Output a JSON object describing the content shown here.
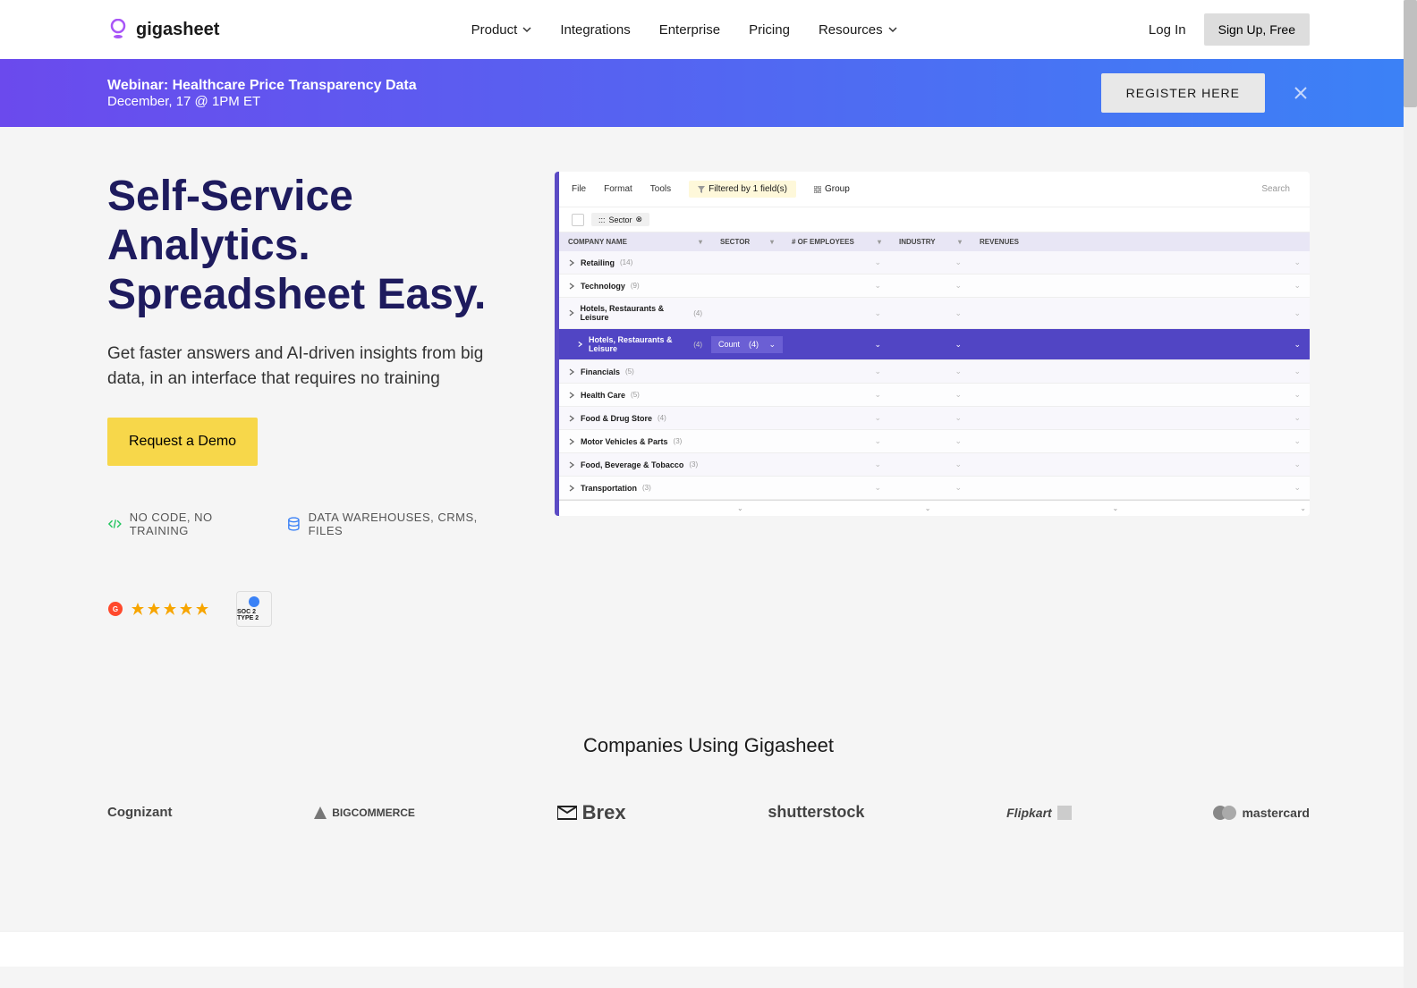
{
  "header": {
    "brand": "gigasheet",
    "nav": {
      "product": "Product",
      "integrations": "Integrations",
      "enterprise": "Enterprise",
      "pricing": "Pricing",
      "resources": "Resources"
    },
    "login": "Log In",
    "signup": "Sign Up, Free"
  },
  "banner": {
    "title": "Webinar: Healthcare Price Transparency Data",
    "subtitle": "December, 17 @ 1PM ET",
    "register": "REGISTER HERE"
  },
  "hero": {
    "title_line1": "Self-Service Analytics.",
    "title_line2": "Spreadsheet Easy.",
    "subtitle": "Get faster answers and AI-driven insights from big data, in an interface that requires no training",
    "cta": "Request a Demo",
    "tag1": "NO CODE, NO TRAINING",
    "tag2": "DATA WAREHOUSES, CRMS, FILES",
    "soc_label": "SOC 2 TYPE 2"
  },
  "screenshot": {
    "menu": {
      "file": "File",
      "format": "Format",
      "tools": "Tools"
    },
    "filter_label": "Filtered by 1 field(s)",
    "group_label": "Group",
    "search_placeholder": "Search",
    "chip": "Sector",
    "headers": {
      "c0": "COMPANY NAME",
      "c1": "SECTOR",
      "c2": "# OF EMPLOYEES",
      "c3": "INDUSTRY",
      "c4": "REVENUES"
    },
    "rows": [
      {
        "label": "Retailing",
        "count": "(14)"
      },
      {
        "label": "Technology",
        "count": "(9)"
      },
      {
        "label": "Hotels, Restaurants & Leisure",
        "count": "(4)"
      },
      {
        "label": "Hotels, Restaurants & Leisure",
        "count": "(4)",
        "highlight": true,
        "agg": "Count",
        "agg_count": "(4)"
      },
      {
        "label": "Financials",
        "count": "(5)"
      },
      {
        "label": "Health Care",
        "count": "(5)"
      },
      {
        "label": "Food & Drug Store",
        "count": "(4)"
      },
      {
        "label": "Motor Vehicles & Parts",
        "count": "(3)"
      },
      {
        "label": "Food, Beverage & Tobacco",
        "count": "(3)"
      },
      {
        "label": "Transportation",
        "count": "(3)"
      }
    ]
  },
  "companies": {
    "title": "Companies Using Gigasheet",
    "logos": {
      "cognizant": "Cognizant",
      "bigcommerce": "BIGCOMMERCE",
      "brex": "Brex",
      "shutterstock": "shutterstock",
      "flipkart": "Flipkart",
      "mastercard": "mastercard"
    }
  }
}
